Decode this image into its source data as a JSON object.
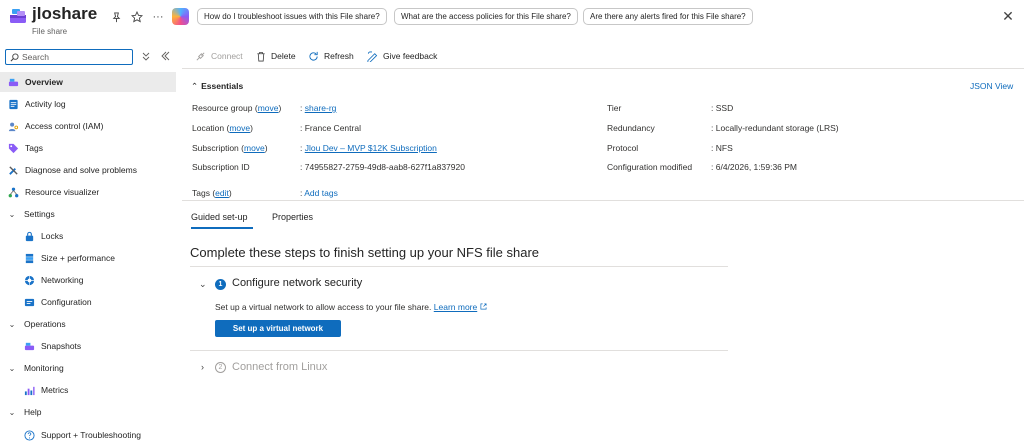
{
  "header": {
    "title": "jloshare",
    "subtitle": "File share",
    "suggestions": [
      "How do I troubleshoot issues with this File share?",
      "What are the access policies for this File share?",
      "Are there any alerts fired for this File share?"
    ],
    "more_glyph": "···",
    "close_glyph": "✕"
  },
  "sidebar": {
    "search_placeholder": "Search",
    "items": [
      {
        "label": "Overview",
        "icon": "file-share-icon"
      },
      {
        "label": "Activity log",
        "icon": "activity-log-icon"
      },
      {
        "label": "Access control (IAM)",
        "icon": "iam-icon"
      },
      {
        "label": "Tags",
        "icon": "tag-icon"
      },
      {
        "label": "Diagnose and solve problems",
        "icon": "wrench-icon"
      },
      {
        "label": "Resource visualizer",
        "icon": "visualizer-icon"
      },
      {
        "label": "Settings",
        "icon": "chevron-down-icon"
      },
      {
        "label": "Locks",
        "icon": "lock-icon"
      },
      {
        "label": "Size + performance",
        "icon": "storage-icon"
      },
      {
        "label": "Networking",
        "icon": "network-icon"
      },
      {
        "label": "Configuration",
        "icon": "config-icon"
      },
      {
        "label": "Operations",
        "icon": "chevron-down-icon"
      },
      {
        "label": "Snapshots",
        "icon": "snapshot-icon"
      },
      {
        "label": "Monitoring",
        "icon": "chevron-down-icon"
      },
      {
        "label": "Metrics",
        "icon": "metrics-icon"
      },
      {
        "label": "Help",
        "icon": "chevron-down-icon"
      },
      {
        "label": "Support + Troubleshooting",
        "icon": "help-icon"
      }
    ]
  },
  "toolbar": {
    "connect": "Connect",
    "delete": "Delete",
    "refresh": "Refresh",
    "feedback": "Give feedback"
  },
  "essentials": {
    "title": "Essentials",
    "json_view": "JSON View",
    "move": "move",
    "edit": "edit",
    "left": [
      {
        "label": "Resource group",
        "value": "share-rg"
      },
      {
        "label": "Location",
        "value": "France Central"
      },
      {
        "label": "Subscription",
        "value": "Jlou Dev – MVP $12K Subscription"
      },
      {
        "label": "Subscription ID",
        "value": "74955827-2759-49d8-aab8-627f1a837920"
      }
    ],
    "right": [
      {
        "label": "Tier",
        "value": "SSD"
      },
      {
        "label": "Redundancy",
        "value": "Locally-redundant storage (LRS)"
      },
      {
        "label": "Protocol",
        "value": "NFS"
      },
      {
        "label": "Configuration modified",
        "value": "6/4/2026, 1:59:36 PM"
      }
    ],
    "tags_label": "Tags",
    "tags_value": "Add tags"
  },
  "tabs": [
    "Guided set-up",
    "Properties"
  ],
  "guide": {
    "title": "Complete these steps to finish setting up your NFS file share",
    "steps": [
      {
        "num": "1",
        "title": "Configure network security",
        "desc": "Set up a virtual network to allow access to your file share.",
        "link": "Learn more",
        "button": "Set up a virtual network"
      },
      {
        "num": "2",
        "title": "Connect from Linux"
      }
    ]
  },
  "colors": {
    "accent": "#0f6cbd",
    "active_bg": "#ebebeb"
  }
}
